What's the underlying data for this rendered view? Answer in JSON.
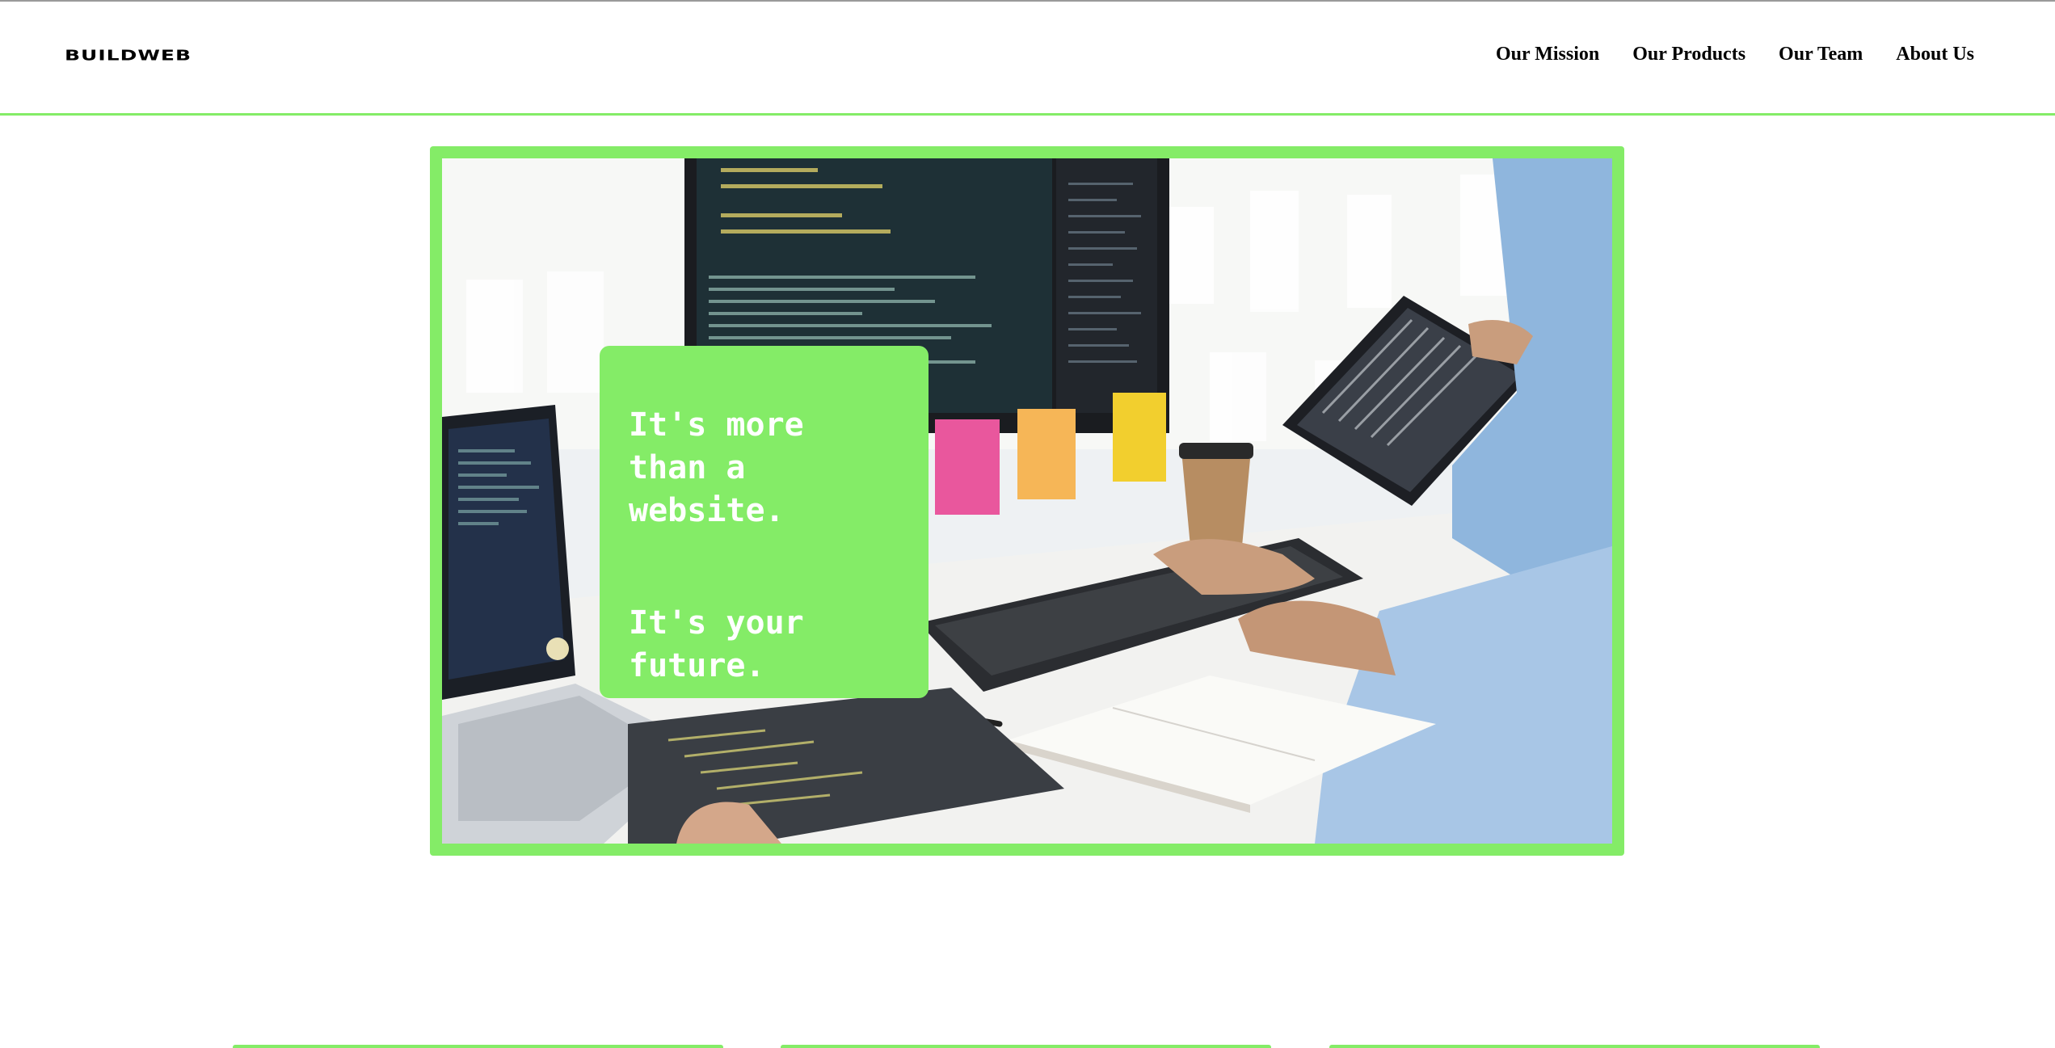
{
  "header": {
    "logo": "BUILDWEB",
    "nav": [
      {
        "label": "Our Mission"
      },
      {
        "label": "Our Products"
      },
      {
        "label": "Our Team"
      },
      {
        "label": "About Us"
      }
    ]
  },
  "hero": {
    "headline_1": "It's more than a website.",
    "headline_2": "It's your future."
  },
  "colors": {
    "accent": "#84ec67",
    "text": "#000000",
    "callout_text": "#ffffff"
  }
}
